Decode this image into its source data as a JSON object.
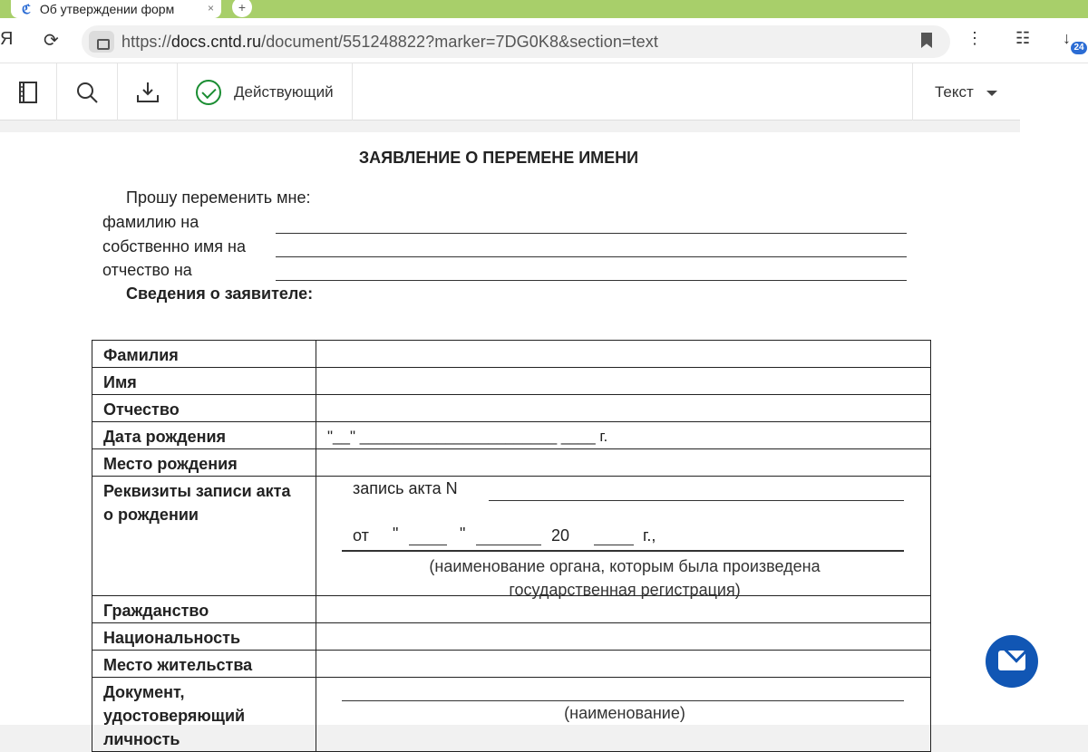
{
  "browser": {
    "tab_title": "Об утверждении форм",
    "tab_close": "×",
    "new_tab": "+",
    "url_scheme": "https://",
    "url_host": "docs.cntd.ru",
    "url_path": "/document/551248822?marker=7DG0K8&section=text",
    "downloads_count": "24",
    "nav_left_glyph": "Я"
  },
  "site_toolbar": {
    "status_label": "Действующий",
    "view_label": "Текст"
  },
  "document": {
    "title": "ЗАЯВЛЕНИЕ О ПЕРЕМЕНЕ ИМЕНИ",
    "intro": "Прошу переменить мне:",
    "surname_label": "фамилию на",
    "name_label": "собственно имя на",
    "patronymic_label": "отчество на",
    "applicant_heading": "Сведения о заявителе:",
    "rows": {
      "surname": "Фамилия",
      "name": "Имя",
      "patronymic": "Отчество",
      "birth_date": "Дата рождения",
      "birth_date_value": "\"__\" _______________________ ____ г.",
      "birth_place": "Место рождения",
      "act_record": "Реквизиты записи акта о рождении",
      "act_record_no": "запись акта N",
      "act_from": "от",
      "act_quote_open": "\"",
      "act_quote_close": "\"",
      "act_year": "20",
      "act_year_suffix": "г.,",
      "act_authority_note": "(наименование органа, которым была произведена государственная регистрация)",
      "citizenship": "Гражданство",
      "nationality": "Национальность",
      "residence": "Место жительства",
      "id_document": "Документ, удостоверяющий личность",
      "id_document_note": "(наименование)"
    }
  }
}
